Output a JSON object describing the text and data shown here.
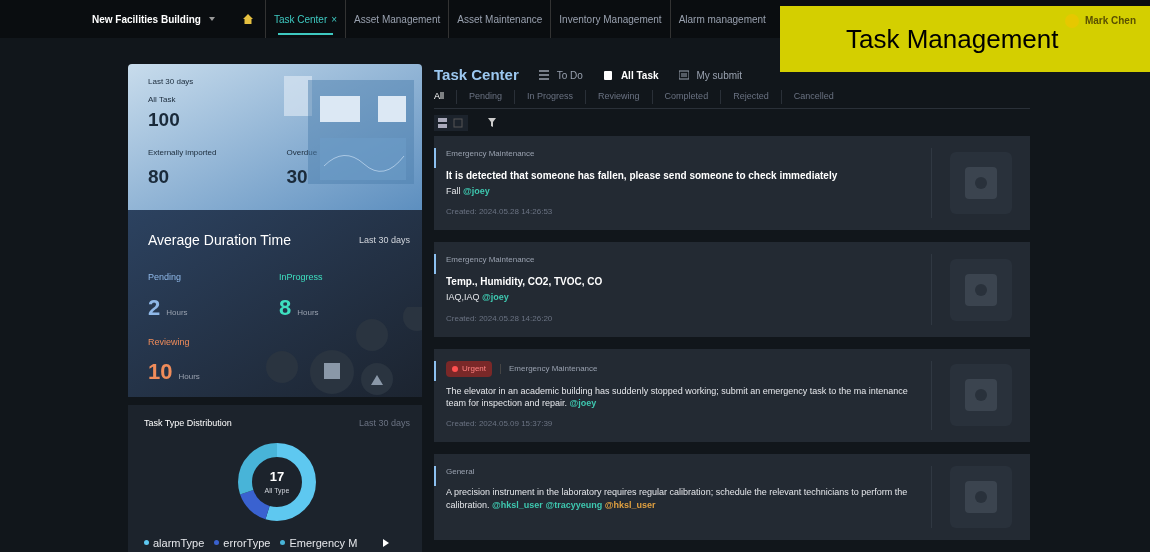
{
  "top_nav": {
    "building": "New Facilities Building",
    "tabs": [
      {
        "label": "Task Center",
        "selected": true,
        "close": "×"
      },
      {
        "label": "Asset Management",
        "selected": false
      },
      {
        "label": "Asset Maintenance",
        "selected": false
      },
      {
        "label": "Inventory Management",
        "selected": false
      },
      {
        "label": "Alarm management",
        "selected": false
      }
    ],
    "user": "Mark Chen"
  },
  "banner": "Task Management",
  "summary": {
    "period": "Last 30 days",
    "stats": [
      {
        "label": "All Task",
        "value": "100"
      },
      {
        "label": "Externally imported",
        "value": "80"
      },
      {
        "label": "Overdue",
        "value": "30"
      }
    ]
  },
  "duration": {
    "title": "Average Duration Time",
    "period": "Last 30 days",
    "items": [
      {
        "label": "Pending",
        "value": "2",
        "unit": "Hours",
        "color": "#8fb8e8"
      },
      {
        "label": "InProgress",
        "value": "8",
        "unit": "Hours",
        "color": "#3ee0c0"
      },
      {
        "label": "Reviewing",
        "value": "10",
        "unit": "Hours",
        "color": "#f08c5a"
      }
    ]
  },
  "distribution": {
    "title": "Task Type Distribution",
    "period": "Last 30 days",
    "total": "17",
    "total_label": "All Type",
    "legend": [
      {
        "label": "alarmType",
        "color": "#5ec8f0"
      },
      {
        "label": "errorType",
        "color": "#3a62d0"
      },
      {
        "label": "Emergency M",
        "color": "#48b4d8"
      }
    ]
  },
  "task_center": {
    "title": "Task Center",
    "views": [
      {
        "label": "To Do",
        "selected": false
      },
      {
        "label": "All Task",
        "selected": true
      },
      {
        "label": "My submit",
        "selected": false
      }
    ],
    "filters": [
      {
        "label": "All",
        "selected": true
      },
      {
        "label": "Pending",
        "selected": false
      },
      {
        "label": "In Progress",
        "selected": false
      },
      {
        "label": "Reviewing",
        "selected": false
      },
      {
        "label": "Completed",
        "selected": false
      },
      {
        "label": "Rejected",
        "selected": false
      },
      {
        "label": "Cancelled",
        "selected": false
      }
    ],
    "tasks": [
      {
        "category": "Emergency Maintenance",
        "urgent": false,
        "title": "It is detected that someone has fallen, please send someone to check immediately",
        "body": "Fall",
        "mentions": [
          {
            "text": "@joey",
            "color": "#3ec8b0"
          }
        ],
        "created": "Created: 2024.05.28 14:26:53"
      },
      {
        "category": "Emergency Maintenance",
        "urgent": false,
        "title": "Temp., Humidity, CO2, TVOC, CO",
        "body": "IAQ,IAQ",
        "mentions": [
          {
            "text": "@joey",
            "color": "#3ec8b0"
          }
        ],
        "created": "Created: 2024.05.28 14:26:20"
      },
      {
        "category": "Emergency Maintenance",
        "urgent": true,
        "urgent_label": "Urgent",
        "body": "The elevator in an academic building has suddenly stopped working; submit an emergency task to the ma intenance team for inspection and repair.",
        "mentions": [
          {
            "text": "@joey",
            "color": "#3ec8b0"
          }
        ],
        "created": "Created: 2024.05.09 15:37:39"
      },
      {
        "category": "General",
        "urgent": false,
        "body": "A precision instrument in the laboratory requires regular calibration; schedule the relevant technicians to perform the calibration.",
        "mentions": [
          {
            "text": "@hksl_user",
            "color": "#3ec8b0"
          },
          {
            "text": "@tracyyeung",
            "color": "#3ec8b0"
          },
          {
            "text": "@hksl_user",
            "color": "#e0a040"
          }
        ]
      }
    ]
  }
}
